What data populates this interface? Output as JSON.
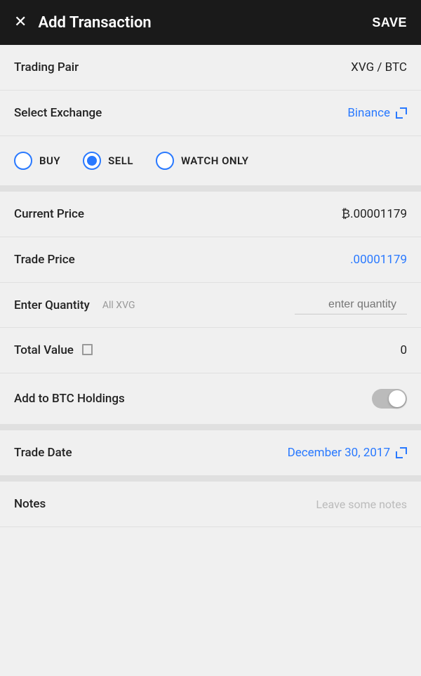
{
  "header": {
    "close_label": "✕",
    "title": "Add Transaction",
    "save_label": "SAVE"
  },
  "trading_pair": {
    "label": "Trading Pair",
    "value": "XVG / BTC"
  },
  "select_exchange": {
    "label": "Select Exchange",
    "value": "Binance"
  },
  "transaction_type": {
    "options": [
      {
        "id": "buy",
        "label": "BUY",
        "selected": false
      },
      {
        "id": "sell",
        "label": "SELL",
        "selected": true
      },
      {
        "id": "watch_only",
        "label": "WATCH ONLY",
        "selected": false
      }
    ]
  },
  "current_price": {
    "label": "Current Price",
    "value": "₿.00001179"
  },
  "trade_price": {
    "label": "Trade Price",
    "value": ".00001179"
  },
  "enter_quantity": {
    "label": "Enter Quantity",
    "all_label": "All XVG",
    "placeholder": "enter quantity"
  },
  "total_value": {
    "label": "Total Value",
    "value": "0"
  },
  "add_to_btc": {
    "label": "Add to BTC Holdings",
    "enabled": false
  },
  "trade_date": {
    "label": "Trade Date",
    "value": "December 30, 2017"
  },
  "notes": {
    "label": "Notes",
    "placeholder": "Leave some notes"
  },
  "colors": {
    "accent": "#2979ff",
    "header_bg": "#1a1a1a",
    "bg": "#f0f0f0"
  }
}
